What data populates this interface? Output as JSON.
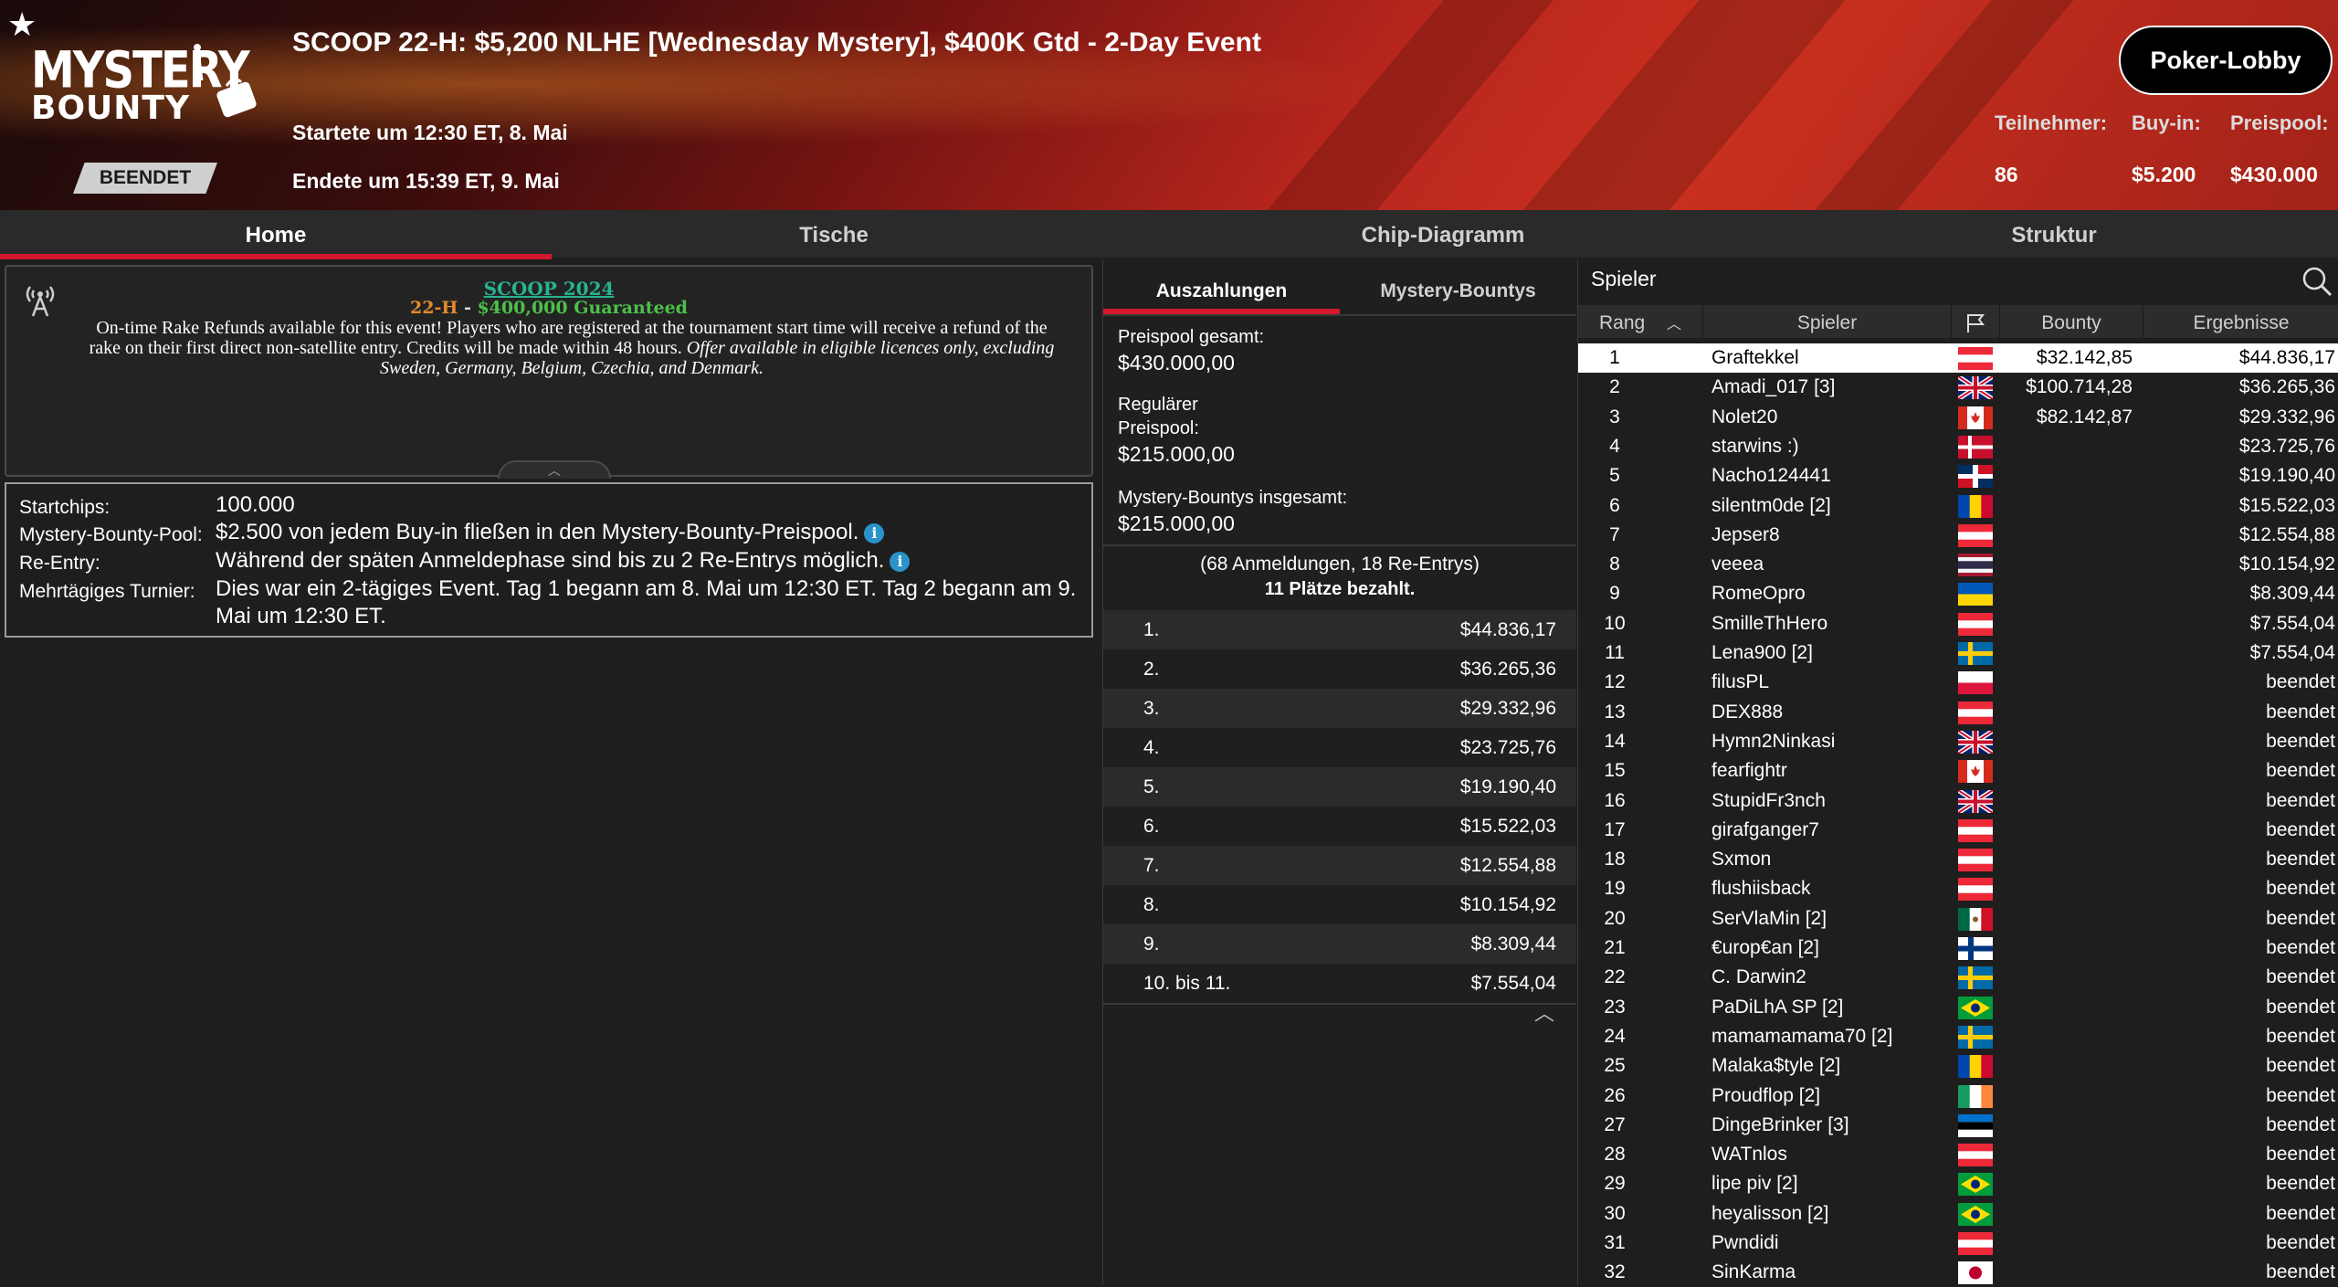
{
  "header": {
    "logo_line1": "MYSTERY",
    "logo_line2": "BOUNTY",
    "status": "BEENDET",
    "title": "SCOOP 22-H: $5,200 NLHE [Wednesday Mystery], $400K Gtd - 2-Day Event",
    "started": "Startete um 12:30 ET, 8. Mai",
    "ended": "Endete um 15:39 ET, 9. Mai",
    "lobby_button": "Poker-Lobby",
    "stats": [
      {
        "label": "Teilnehmer:",
        "value": "86"
      },
      {
        "label": "Buy-in:",
        "value": "$5.200"
      },
      {
        "label": "Preispool:",
        "value": "$430.000"
      }
    ]
  },
  "tabs": [
    "Home",
    "Tische",
    "Chip-Diagramm",
    "Struktur"
  ],
  "promo": {
    "title": "SCOOP 2024",
    "sub_a": "22-H",
    "sub_sep": " - ",
    "sub_b": "$400,000 Guaranteed",
    "text_plain": "On-time Rake Refunds available for this event! Players who are registered at the tournament start time will receive a refund of the rake on their first direct non-satellite entry. Credits will be made within 48 hours.",
    "text_italic": "Offer available in eligible licences only, excluding Sweden, Germany, Belgium, Czechia, and Denmark."
  },
  "info": {
    "startchips_label": "Startchips:",
    "startchips_value": "100.000",
    "bounty_pool_label": "Mystery-Bounty-Pool:",
    "bounty_pool_value": "$2.500 von jedem Buy-in fließen in den Mystery-Bounty-Preispool.",
    "reentry_label": "Re-Entry:",
    "reentry_value": "Während der späten Anmeldephase sind bis zu 2 Re-Entrys möglich.",
    "multiday_label": "Mehrtägiges Turnier:",
    "multiday_value": "Dies war ein 2-tägiges Event. Tag 1 begann am 8. Mai um 12:30 ET. Tag 2 begann am 9. Mai um 12:30 ET."
  },
  "payouts": {
    "subtabs": [
      "Auszahlungen",
      "Mystery-Bountys"
    ],
    "total_label": "Preispool gesamt:",
    "total_value": "$430.000,00",
    "regular_label_1": "Regulärer",
    "regular_label_2": "Preispool:",
    "regular_value": "$215.000,00",
    "bounty_label": "Mystery-Bountys insgesamt:",
    "bounty_value": "$215.000,00",
    "entries": "(68 Anmeldungen, 18 Re-Entrys)",
    "paid": "11 Plätze bezahlt.",
    "rows": [
      {
        "place": "1.",
        "amount": "$44.836,17"
      },
      {
        "place": "2.",
        "amount": "$36.265,36"
      },
      {
        "place": "3.",
        "amount": "$29.332,96"
      },
      {
        "place": "4.",
        "amount": "$23.725,76"
      },
      {
        "place": "5.",
        "amount": "$19.190,40"
      },
      {
        "place": "6.",
        "amount": "$15.522,03"
      },
      {
        "place": "7.",
        "amount": "$12.554,88"
      },
      {
        "place": "8.",
        "amount": "$10.154,92"
      },
      {
        "place": "9.",
        "amount": "$8.309,44"
      },
      {
        "place": "10. bis 11.",
        "amount": "$7.554,04"
      }
    ]
  },
  "players": {
    "title": "Spieler",
    "columns": {
      "rank": "Rang",
      "player": "Spieler",
      "bounty": "Bounty",
      "result": "Ergebnisse"
    },
    "rows": [
      {
        "rank": "1",
        "name": "Graftekkel",
        "flag": "austria",
        "bounty": "$32.142,85",
        "result": "$44.836,17"
      },
      {
        "rank": "2",
        "name": "Amadi_017 [3]",
        "flag": "uk",
        "bounty": "$100.714,28",
        "result": "$36.265,36"
      },
      {
        "rank": "3",
        "name": "Nolet20",
        "flag": "canada",
        "bounty": "$82.142,87",
        "result": "$29.332,96"
      },
      {
        "rank": "4",
        "name": "starwins :)",
        "flag": "denmark",
        "bounty": "",
        "result": "$23.725,76"
      },
      {
        "rank": "5",
        "name": "Nacho124441",
        "flag": "dominican",
        "bounty": "",
        "result": "$19.190,40"
      },
      {
        "rank": "6",
        "name": "silentm0de [2]",
        "flag": "moldova",
        "bounty": "",
        "result": "$15.522,03"
      },
      {
        "rank": "7",
        "name": "Jepser8",
        "flag": "austria",
        "bounty": "",
        "result": "$12.554,88"
      },
      {
        "rank": "8",
        "name": "veeea",
        "flag": "thailand",
        "bounty": "",
        "result": "$10.154,92"
      },
      {
        "rank": "9",
        "name": "RomeOpro",
        "flag": "ukraine",
        "bounty": "",
        "result": "$8.309,44"
      },
      {
        "rank": "10",
        "name": "SmilleThHero",
        "flag": "austria",
        "bounty": "",
        "result": "$7.554,04"
      },
      {
        "rank": "11",
        "name": "Lena900 [2]",
        "flag": "sweden",
        "bounty": "",
        "result": "$7.554,04"
      },
      {
        "rank": "12",
        "name": "filusPL",
        "flag": "poland",
        "bounty": "",
        "result": "beendet"
      },
      {
        "rank": "13",
        "name": "DEX888",
        "flag": "austria",
        "bounty": "",
        "result": "beendet"
      },
      {
        "rank": "14",
        "name": "Hymn2Ninkasi",
        "flag": "uk",
        "bounty": "",
        "result": "beendet"
      },
      {
        "rank": "15",
        "name": "fearfightr",
        "flag": "canada",
        "bounty": "",
        "result": "beendet"
      },
      {
        "rank": "16",
        "name": "StupidFr3nch",
        "flag": "uk",
        "bounty": "",
        "result": "beendet"
      },
      {
        "rank": "17",
        "name": "girafganger7",
        "flag": "austria",
        "bounty": "",
        "result": "beendet"
      },
      {
        "rank": "18",
        "name": "Sxmon",
        "flag": "austria",
        "bounty": "",
        "result": "beendet"
      },
      {
        "rank": "19",
        "name": "flushiisback",
        "flag": "austria",
        "bounty": "",
        "result": "beendet"
      },
      {
        "rank": "20",
        "name": "SerVlaMin [2]",
        "flag": "mexico",
        "bounty": "",
        "result": "beendet"
      },
      {
        "rank": "21",
        "name": "€urop€an [2]",
        "flag": "finland",
        "bounty": "",
        "result": "beendet"
      },
      {
        "rank": "22",
        "name": "C. Darwin2",
        "flag": "sweden",
        "bounty": "",
        "result": "beendet"
      },
      {
        "rank": "23",
        "name": "PaDiLhA SP [2]",
        "flag": "brazil",
        "bounty": "",
        "result": "beendet"
      },
      {
        "rank": "24",
        "name": "mamamamama70 [2]",
        "flag": "sweden",
        "bounty": "",
        "result": "beendet"
      },
      {
        "rank": "25",
        "name": "Malaka$tyle [2]",
        "flag": "moldova",
        "bounty": "",
        "result": "beendet"
      },
      {
        "rank": "26",
        "name": "Proudflop [2]",
        "flag": "ireland",
        "bounty": "",
        "result": "beendet"
      },
      {
        "rank": "27",
        "name": "DingeBrinker [3]",
        "flag": "estonia",
        "bounty": "",
        "result": "beendet"
      },
      {
        "rank": "28",
        "name": "WATnlos",
        "flag": "austria",
        "bounty": "",
        "result": "beendet"
      },
      {
        "rank": "29",
        "name": "lipe piv [2]",
        "flag": "brazil",
        "bounty": "",
        "result": "beendet"
      },
      {
        "rank": "30",
        "name": "heyalisson [2]",
        "flag": "brazil",
        "bounty": "",
        "result": "beendet"
      },
      {
        "rank": "31",
        "name": "Pwndidi",
        "flag": "austria",
        "bounty": "",
        "result": "beendet"
      },
      {
        "rank": "32",
        "name": "SinKarma",
        "flag": "japan",
        "bounty": "",
        "result": "beendet"
      }
    ]
  },
  "colors": {
    "accent": "#d3172e",
    "link": "#27b38f",
    "info_icon": "#2a93c9"
  }
}
